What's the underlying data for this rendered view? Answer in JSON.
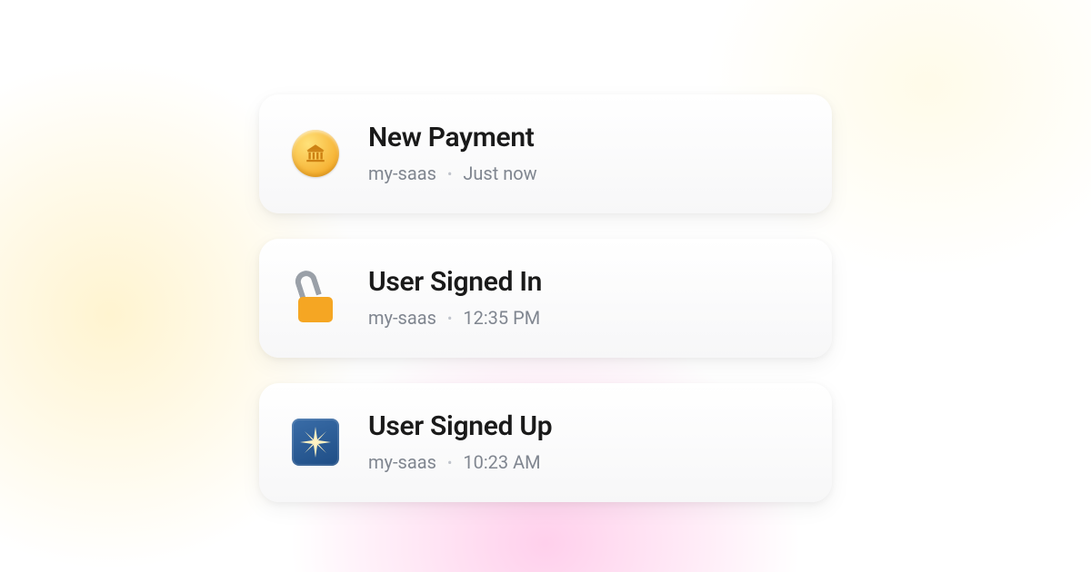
{
  "notifications": [
    {
      "icon": "coin-bank-icon",
      "title": "New Payment",
      "project": "my-saas",
      "time": "Just now"
    },
    {
      "icon": "unlock-icon",
      "title": "User Signed In",
      "project": "my-saas",
      "time": "12:35 PM"
    },
    {
      "icon": "sparkle-tile-icon",
      "title": "User Signed Up",
      "project": "my-saas",
      "time": "10:23 AM"
    }
  ],
  "separator": "•",
  "colors": {
    "text_primary": "#1a1a1a",
    "text_muted": "#808690",
    "accent_orange": "#f5a623",
    "accent_blue": "#1e4d85"
  }
}
